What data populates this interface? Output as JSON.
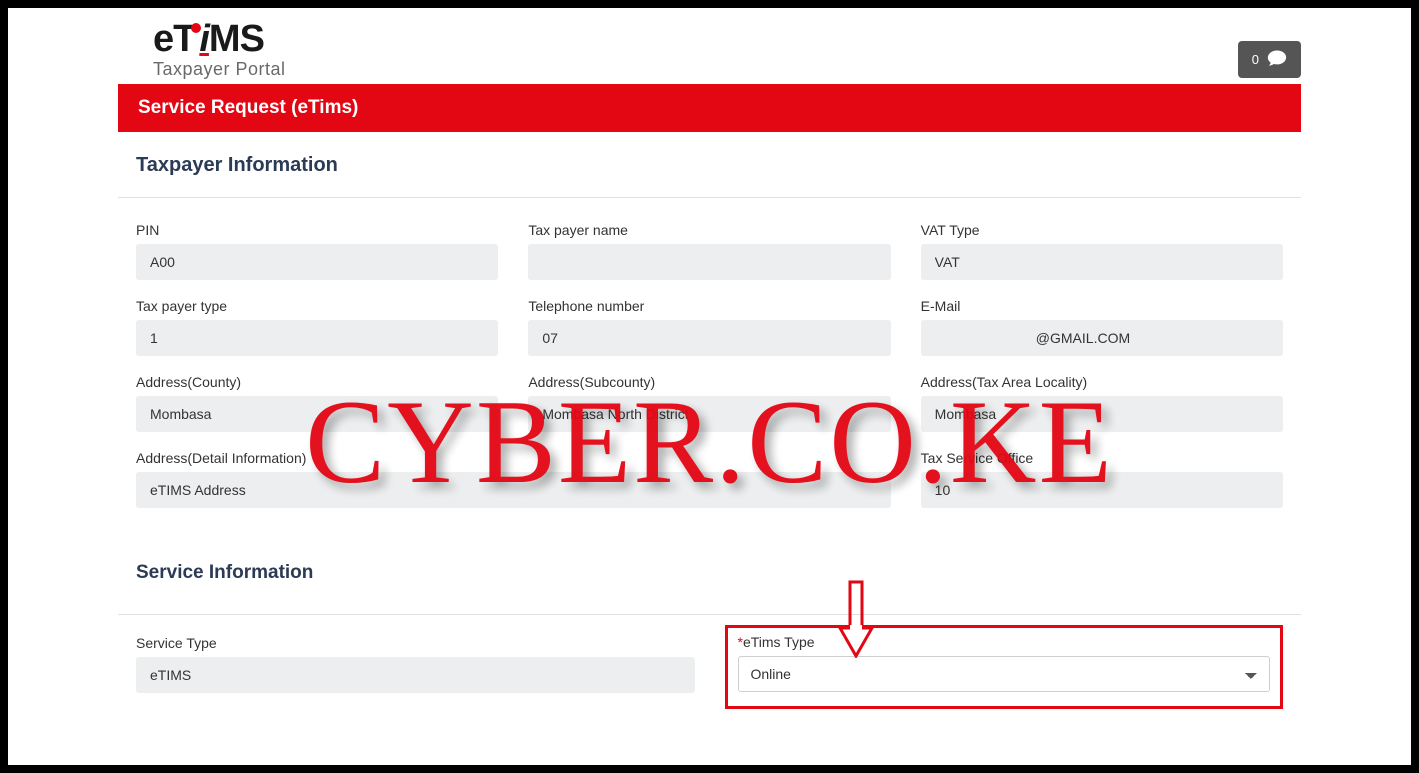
{
  "logo": {
    "main_pre": "eT",
    "main_i": "i",
    "main_post": "MS",
    "sub": "Taxpayer Portal"
  },
  "notif": {
    "count": "0"
  },
  "panel_title": "Service Request (eTims)",
  "taxpayer_section": {
    "title": "Taxpayer Information",
    "fields": {
      "pin": {
        "label": "PIN",
        "value": "A00"
      },
      "name": {
        "label": "Tax payer name",
        "value": ""
      },
      "vat_type": {
        "label": "VAT Type",
        "value": "VAT"
      },
      "payer_type": {
        "label": "Tax payer type",
        "value": "1"
      },
      "telephone": {
        "label": "Telephone number",
        "value": "07"
      },
      "email": {
        "label": "E-Mail",
        "value": "                          @GMAIL.COM"
      },
      "county": {
        "label": "Address(County)",
        "value": "Mombasa"
      },
      "subcounty": {
        "label": "Address(Subcounty)",
        "value": "Mombasa North District"
      },
      "locality": {
        "label": "Address(Tax Area Locality)",
        "value": "Mombasa"
      },
      "detail": {
        "label": "Address(Detail Information)",
        "value": "eTIMS Address"
      },
      "tax_office": {
        "label": "Tax Service Office",
        "value": "10"
      }
    }
  },
  "service_section": {
    "title": "Service Information",
    "service_type": {
      "label": "Service Type",
      "value": "eTIMS"
    },
    "etims_type": {
      "label": "eTims Type",
      "value": "Online"
    }
  },
  "watermark": "CYBER.CO.KE"
}
